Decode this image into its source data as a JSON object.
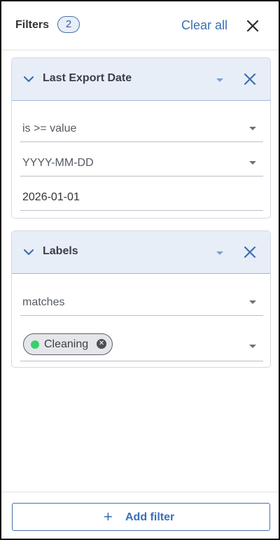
{
  "header": {
    "title": "Filters",
    "count": "2",
    "clear_all": "Clear all"
  },
  "filters": [
    {
      "title": "Last Export Date",
      "fields": [
        {
          "text": "is >= value",
          "kind": "select"
        },
        {
          "text": "YYYY-MM-DD",
          "kind": "select"
        },
        {
          "text": "2026-01-01",
          "kind": "input"
        }
      ]
    },
    {
      "title": "Labels",
      "fields": [
        {
          "text": "matches",
          "kind": "select"
        }
      ],
      "chips": [
        {
          "label": "Cleaning",
          "color": "#3ccf6e"
        }
      ]
    }
  ],
  "footer": {
    "add_filter": "Add filter",
    "add_icon": "+"
  },
  "colors": {
    "accent": "#3b6fb4",
    "card_header_bg": "#e8eef8"
  },
  "icons": {
    "close": "close-icon",
    "chevron": "chevron-down-icon",
    "caret": "caret-down-icon",
    "chip_remove": "x-circle-icon"
  }
}
